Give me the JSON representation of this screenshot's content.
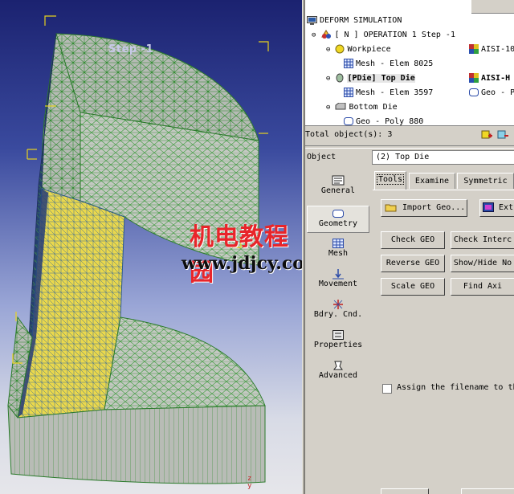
{
  "viewport": {
    "step_label": "Step  -1",
    "watermark_cn": "机电教程园",
    "watermark_url": "www.jdjcy.com",
    "axis_z": "z",
    "axis_y": "y",
    "colors": {
      "mesh_line": "#2b7a2b",
      "face_gray": "#b4b8b4",
      "face_yellow": "#e9d74a",
      "bracket": "#e8d21e"
    }
  },
  "tree": {
    "root": "DEFORM SIMULATION",
    "operation": "[ N ]  OPERATION 1  Step -1",
    "workpiece": "Workpiece",
    "workpiece_mesh": "Mesh - Elem 8025",
    "workpiece_material": "AISI-10",
    "topdie": "[PDie] Top Die",
    "topdie_mesh": "Mesh - Elem 3597",
    "topdie_material": "AISI-H",
    "topdie_geo": "Geo - P",
    "bottomdie": "Bottom Die",
    "bottomdie_geo": "Geo - Poly 880"
  },
  "status": {
    "total_objects": "Total object(s): 3"
  },
  "object": {
    "label": "Object",
    "value": "(2) Top Die"
  },
  "sidenav": [
    {
      "label": "General",
      "icon": "general-icon"
    },
    {
      "label": "Geometry",
      "icon": "geometry-icon"
    },
    {
      "label": "Mesh",
      "icon": "mesh-icon"
    },
    {
      "label": "Movement",
      "icon": "movement-icon"
    },
    {
      "label": "Bdry. Cnd.",
      "icon": "boundary-icon"
    },
    {
      "label": "Properties",
      "icon": "properties-icon"
    },
    {
      "label": "Advanced",
      "icon": "advanced-icon"
    }
  ],
  "tabs": {
    "tools": "Tools",
    "examine": "Examine",
    "symmetric": "Symmetric"
  },
  "buttons": {
    "import_geo": "Import Geo...",
    "ext": "Ext",
    "check_geo": "Check GEO",
    "check_inter": "Check Interc",
    "reverse_geo": "Reverse GEO",
    "show_hide": "Show/Hide No",
    "scale_geo": "Scale GEO",
    "find_axis": "Find Axi"
  },
  "assign_label": "Assign the filename to th"
}
